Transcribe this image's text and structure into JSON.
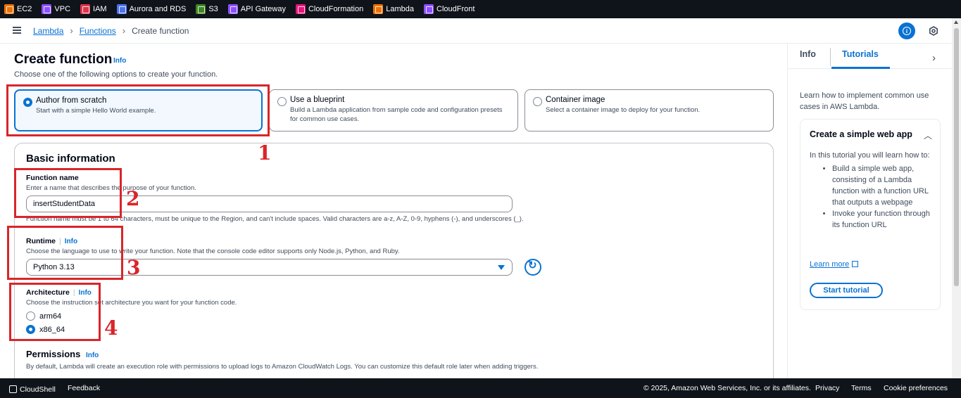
{
  "services": [
    {
      "label": "EC2",
      "color": "#ed7100"
    },
    {
      "label": "VPC",
      "color": "#8c4fff"
    },
    {
      "label": "IAM",
      "color": "#dd344c"
    },
    {
      "label": "Aurora and RDS",
      "color": "#4d72f3"
    },
    {
      "label": "S3",
      "color": "#3f8624"
    },
    {
      "label": "API Gateway",
      "color": "#8c4fff"
    },
    {
      "label": "CloudFormation",
      "color": "#e7157b"
    },
    {
      "label": "Lambda",
      "color": "#ed7100"
    },
    {
      "label": "CloudFront",
      "color": "#8c4fff"
    }
  ],
  "breadcrumb": {
    "root": "Lambda",
    "section": "Functions",
    "current": "Create function",
    "separator": "›"
  },
  "page": {
    "title": "Create function",
    "info": "Info",
    "subtitle": "Choose one of the following options to create your function."
  },
  "options": [
    {
      "title": "Author from scratch",
      "desc": "Start with a simple Hello World example.",
      "selected": true
    },
    {
      "title": "Use a blueprint",
      "desc": "Build a Lambda application from sample code and configuration presets for common use cases.",
      "selected": false
    },
    {
      "title": "Container image",
      "desc": "Select a container image to deploy for your function.",
      "selected": false
    }
  ],
  "basic": {
    "title": "Basic information",
    "function_name": {
      "label": "Function name",
      "desc": "Enter a name that describes the purpose of your function.",
      "value": "insertStudentData",
      "hint": "Function name must be 1 to 64 characters, must be unique to the Region, and can't include spaces. Valid characters are a-z, A-Z, 0-9, hyphens (-), and underscores (_)."
    },
    "runtime": {
      "label": "Runtime",
      "info": "Info",
      "desc": "Choose the language to use to write your function. Note that the console code editor supports only Node.js, Python, and Ruby.",
      "value": "Python 3.13"
    },
    "architecture": {
      "label": "Architecture",
      "info": "Info",
      "desc": "Choose the instruction set architecture you want for your function code.",
      "options": [
        {
          "label": "arm64",
          "selected": false
        },
        {
          "label": "x86_64",
          "selected": true
        }
      ]
    },
    "permissions": {
      "label": "Permissions",
      "info": "Info",
      "desc": "By default, Lambda will create an execution role with permissions to upload logs to Amazon CloudWatch Logs. You can customize this default role later when adding triggers."
    }
  },
  "annotations": [
    "1",
    "2",
    "3",
    "4"
  ],
  "right_panel": {
    "tabs": [
      "Info",
      "Tutorials"
    ],
    "active_tab": "Tutorials",
    "intro": "Learn how to implement common use cases in AWS Lambda.",
    "card": {
      "title": "Create a simple web app",
      "body": "In this tutorial you will learn how to:",
      "bullets": [
        "Build a simple web app, consisting of a Lambda function with a function URL that outputs a webpage",
        "Invoke your function through its function URL"
      ],
      "learn_more": "Learn more",
      "button": "Start tutorial"
    }
  },
  "footer": {
    "cloudshell": "CloudShell",
    "feedback": "Feedback",
    "copyright": "© 2025, Amazon Web Services, Inc. or its affiliates.",
    "privacy": "Privacy",
    "terms": "Terms",
    "cookies": "Cookie preferences"
  },
  "icons": [
    "menu-icon",
    "chevron-right-icon",
    "info-icon",
    "settings-icon",
    "refresh-icon",
    "external-link-icon",
    "chevron-up-icon",
    "cloudshell-icon"
  ]
}
